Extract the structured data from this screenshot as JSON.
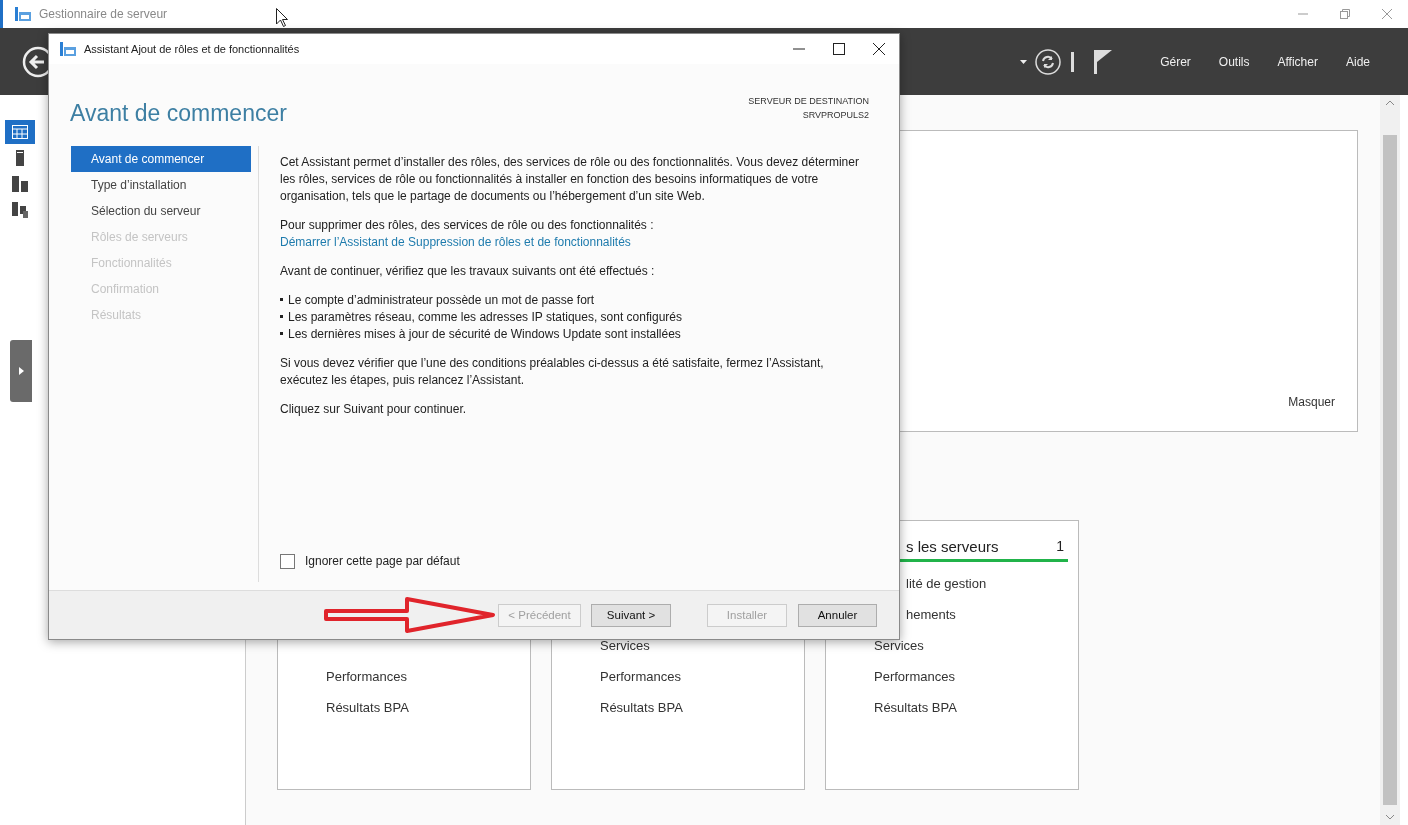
{
  "server_manager": {
    "title": "Gestionnaire de serveur",
    "menus": [
      "Gérer",
      "Outils",
      "Afficher",
      "Aide"
    ],
    "sidebar": {
      "items": [
        {
          "kind": "dashboard",
          "selected": true
        },
        {
          "kind": "local",
          "selected": false
        },
        {
          "kind": "all",
          "selected": false
        },
        {
          "kind": "roles",
          "selected": false
        }
      ]
    },
    "welcome": {
      "hide_link": "Masquer"
    },
    "tiles": [
      {
        "rows": [
          {
            "text": "Performances",
            "partial": false
          },
          {
            "text": "Résultats BPA",
            "partial": false
          }
        ]
      },
      {
        "rows": [
          {
            "text": "Services",
            "partial": false
          },
          {
            "text": "Performances",
            "partial": false
          },
          {
            "text": "Résultats BPA",
            "partial": false
          }
        ]
      },
      {
        "title": "s les serveurs",
        "count": "1",
        "rows": [
          {
            "text": "lité de gestion",
            "partial": true
          },
          {
            "text": "hements",
            "partial": true
          },
          {
            "text": "Services",
            "partial": false
          },
          {
            "text": "Performances",
            "partial": false
          },
          {
            "text": "Résultats BPA",
            "partial": false
          }
        ]
      }
    ]
  },
  "wizard": {
    "title": "Assistant Ajout de rôles et de fonctionnalités",
    "heading": "Avant de commencer",
    "destination_label": "SERVEUR DE DESTINATION",
    "destination_server": "SRVPROPULS2",
    "steps": [
      {
        "label": "Avant de commencer",
        "selected": true,
        "disabled": false
      },
      {
        "label": "Type d’installation",
        "selected": false,
        "disabled": false
      },
      {
        "label": "Sélection du serveur",
        "selected": false,
        "disabled": false
      },
      {
        "label": "Rôles de serveurs",
        "selected": false,
        "disabled": true
      },
      {
        "label": "Fonctionnalités",
        "selected": false,
        "disabled": true
      },
      {
        "label": "Confirmation",
        "selected": false,
        "disabled": true
      },
      {
        "label": "Résultats",
        "selected": false,
        "disabled": true
      }
    ],
    "intro": "Cet Assistant permet d’installer des rôles, des services de rôle ou des fonctionnalités. Vous devez déterminer les rôles, services de rôle ou fonctionnalités à installer en fonction des besoins informatiques de votre organisation, tels que le partage de documents ou l’hébergement d’un site Web.",
    "remove_text": "Pour supprimer des rôles, des services de rôle ou des fonctionnalités :",
    "remove_link": "Démarrer l’Assistant de Suppression de rôles et de fonctionnalités",
    "checklist_intro": "Avant de continuer, vérifiez que les travaux suivants ont été effectués :",
    "checklist": [
      "Le compte d’administrateur possède un mot de passe fort",
      "Les paramètres réseau, comme les adresses IP statiques, sont configurés",
      "Les dernières mises à jour de sécurité de Windows Update sont installées"
    ],
    "note": "Si vous devez vérifier que l’une des conditions préalables ci-dessus a été satisfaite, fermez l’Assistant, exécutez les étapes, puis relancez l’Assistant.",
    "continue_text": "Cliquez sur Suivant pour continuer.",
    "skip_checkbox": {
      "label": "Ignorer cette page par défaut",
      "checked": false
    },
    "buttons": [
      {
        "label": "< Précédent",
        "disabled": true
      },
      {
        "label": "Suivant >",
        "disabled": false
      },
      {
        "label": "Installer",
        "disabled": true
      },
      {
        "label": "Annuler",
        "disabled": false
      }
    ]
  }
}
